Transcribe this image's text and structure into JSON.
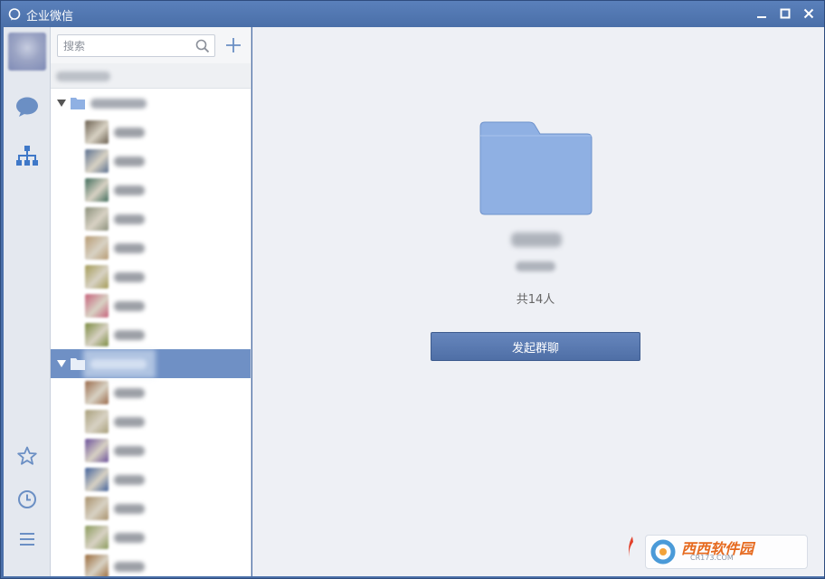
{
  "window": {
    "title": "企业微信"
  },
  "rail": {
    "items": [
      {
        "name": "chat-icon"
      },
      {
        "name": "org-icon"
      },
      {
        "name": "star-icon"
      },
      {
        "name": "clock-icon"
      },
      {
        "name": "menu-icon"
      }
    ]
  },
  "search": {
    "placeholder": "搜索"
  },
  "contacts": {
    "member_avatar_colors": [
      "#6a5f4f",
      "#5a6f8f",
      "#3f6b5a",
      "#8a8f7a",
      "#b79a72",
      "#a39a55",
      "#c6617a",
      "#7a8a3f",
      "#9a6a4a",
      "#a89f7a",
      "#6a4f9a",
      "#3f5f9a",
      "#a8906a",
      "#8a9a5a",
      "#9a6a3a"
    ]
  },
  "detail": {
    "member_count": "共14人",
    "start_chat_label": "发起群聊"
  },
  "watermark": {
    "brand": "西西软件园",
    "domain": "CR173.COM"
  },
  "colors": {
    "accent": "#4a6fa8",
    "selected_row": "#6f90c5",
    "folder": "#8fb0e3"
  }
}
